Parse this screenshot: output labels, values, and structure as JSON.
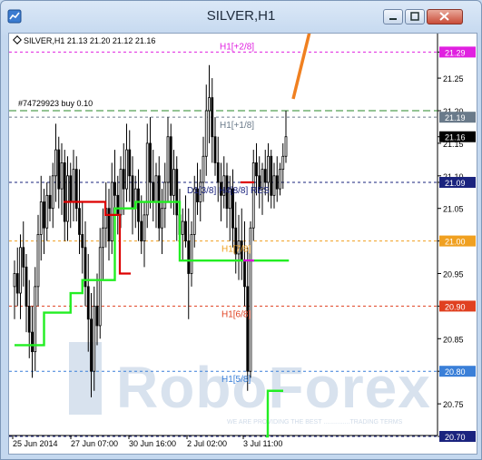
{
  "window": {
    "title": "SILVER,H1",
    "icon": "chart-window-icon",
    "controls": [
      "minimize-icon",
      "maximize-icon",
      "close-icon"
    ]
  },
  "chart_data": {
    "type": "candlestick",
    "symbol_header": "SILVER,H1  21.13 21.20 21.12 21.16",
    "trade_label": "#74729923 buy 0.10",
    "ylim": [
      20.7,
      21.3
    ],
    "y_ticks": [
      "21.29",
      "21.25",
      "21.20",
      "21.16",
      "21.15",
      "21.10",
      "21.09",
      "21.05",
      "21.00",
      "20.95",
      "20.90",
      "20.85",
      "20.80",
      "20.75",
      "20.70"
    ],
    "x_ticks": [
      "25 Jun 2014",
      "27 Jun 07:00",
      "30 Jun 16:00",
      "2 Jul 02:00",
      "3 Jul 11:00"
    ],
    "murrey_levels": [
      {
        "label": "H1[+2/8]",
        "value": 21.29,
        "badge": "21.29",
        "color": "#e020e0"
      },
      {
        "label": "H1[+1/8]",
        "value": 21.19,
        "badge": "21.19",
        "color": "#6a7a8a"
      },
      {
        "label": "D1[3/8] H4[8/8] RES",
        "value": 21.09,
        "badge": "21.09",
        "color": "#1a237e"
      },
      {
        "label": "H1[7/8]",
        "value": 21.0,
        "badge": "21.00",
        "color": "#f0a020"
      },
      {
        "label": "H1[6/8]",
        "value": 20.9,
        "badge": "20.90",
        "color": "#e04020"
      },
      {
        "label": "H1[5/8]",
        "value": 20.8,
        "badge": "20.80",
        "color": "#3a7fd8"
      },
      {
        "label": "",
        "value": 20.7,
        "badge": "20.70",
        "color": "#1a237e"
      }
    ],
    "trade_line": {
      "value": 21.2,
      "color": "#2a8a2a"
    },
    "last_price_badge": "21.16",
    "arrow_color": "#f08020",
    "watermark": {
      "brand": "RoboForex",
      "tagline": "WE ARE PROVIDING THE BEST ...............TRADING TERMS"
    },
    "trend_series": {
      "colors": {
        "up": "#22ee22",
        "down": "#dd0000",
        "flat": "#dd00dd"
      },
      "values": [
        20.84,
        20.84,
        20.84,
        20.84,
        20.84,
        20.84,
        20.84,
        20.84,
        20.84,
        20.84,
        20.89,
        20.89,
        20.89,
        20.89,
        20.89,
        20.89,
        20.89,
        20.89,
        20.89,
        20.92,
        20.92,
        20.92,
        20.92,
        20.94,
        20.94,
        20.94,
        20.94,
        20.94,
        20.94,
        20.94,
        20.94,
        20.94,
        20.94,
        20.94,
        21.05,
        21.05,
        21.05,
        21.05,
        21.05,
        21.05,
        21.05,
        21.06,
        21.06,
        21.06,
        21.06,
        21.06,
        21.06,
        21.06,
        21.06,
        21.06,
        21.06,
        21.06,
        21.06,
        21.06,
        21.06,
        21.06,
        20.97,
        20.97,
        20.97,
        20.97,
        20.97,
        20.97,
        20.97,
        20.97,
        20.97,
        20.97,
        20.97,
        20.97,
        20.97,
        20.97,
        20.97,
        20.97,
        20.97,
        20.97,
        20.97,
        20.97,
        20.97,
        20.97,
        20.97,
        20.97,
        20.97,
        20.97,
        20.97,
        20.97,
        20.97,
        20.97,
        20.97,
        20.97,
        20.97,
        20.97,
        20.97,
        20.97,
        20.97,
        20.97
      ]
    },
    "candles": [
      {
        "o": 20.93,
        "h": 20.97,
        "l": 20.88,
        "c": 20.95
      },
      {
        "o": 20.95,
        "h": 20.99,
        "l": 20.9,
        "c": 20.92
      },
      {
        "o": 20.92,
        "h": 21.01,
        "l": 20.88,
        "c": 20.99
      },
      {
        "o": 20.99,
        "h": 21.03,
        "l": 20.93,
        "c": 20.96
      },
      {
        "o": 20.96,
        "h": 20.98,
        "l": 20.86,
        "c": 20.9
      },
      {
        "o": 20.9,
        "h": 20.94,
        "l": 20.82,
        "c": 20.86
      },
      {
        "o": 20.86,
        "h": 20.9,
        "l": 20.79,
        "c": 20.83
      },
      {
        "o": 20.83,
        "h": 20.96,
        "l": 20.8,
        "c": 20.93
      },
      {
        "o": 20.93,
        "h": 21.04,
        "l": 20.9,
        "c": 21.01
      },
      {
        "o": 21.01,
        "h": 21.1,
        "l": 20.97,
        "c": 21.06
      },
      {
        "o": 21.06,
        "h": 21.08,
        "l": 20.98,
        "c": 21.02
      },
      {
        "o": 21.02,
        "h": 21.09,
        "l": 21.0,
        "c": 21.07
      },
      {
        "o": 21.07,
        "h": 21.1,
        "l": 21.03,
        "c": 21.05
      },
      {
        "o": 21.05,
        "h": 21.12,
        "l": 21.02,
        "c": 21.1
      },
      {
        "o": 21.1,
        "h": 21.18,
        "l": 21.06,
        "c": 21.14
      },
      {
        "o": 21.14,
        "h": 21.16,
        "l": 21.05,
        "c": 21.08
      },
      {
        "o": 21.08,
        "h": 21.15,
        "l": 21.04,
        "c": 21.12
      },
      {
        "o": 21.12,
        "h": 21.14,
        "l": 21.0,
        "c": 21.03
      },
      {
        "o": 21.03,
        "h": 21.13,
        "l": 21.0,
        "c": 21.1
      },
      {
        "o": 21.1,
        "h": 21.12,
        "l": 21.02,
        "c": 21.06
      },
      {
        "o": 21.06,
        "h": 21.14,
        "l": 21.03,
        "c": 21.11
      },
      {
        "o": 21.11,
        "h": 21.13,
        "l": 21.03,
        "c": 21.05
      },
      {
        "o": 21.05,
        "h": 21.11,
        "l": 20.98,
        "c": 21.01
      },
      {
        "o": 21.01,
        "h": 21.06,
        "l": 20.95,
        "c": 20.99
      },
      {
        "o": 20.99,
        "h": 21.03,
        "l": 20.9,
        "c": 20.93
      },
      {
        "o": 20.93,
        "h": 20.98,
        "l": 20.83,
        "c": 20.88
      },
      {
        "o": 20.88,
        "h": 20.92,
        "l": 20.76,
        "c": 20.8
      },
      {
        "o": 20.8,
        "h": 20.93,
        "l": 20.77,
        "c": 20.9
      },
      {
        "o": 20.9,
        "h": 20.95,
        "l": 20.84,
        "c": 20.87
      },
      {
        "o": 20.87,
        "h": 21.02,
        "l": 20.85,
        "c": 20.99
      },
      {
        "o": 20.99,
        "h": 21.05,
        "l": 20.94,
        "c": 21.02
      },
      {
        "o": 21.02,
        "h": 21.09,
        "l": 20.99,
        "c": 21.05
      },
      {
        "o": 21.05,
        "h": 21.08,
        "l": 20.97,
        "c": 21.0
      },
      {
        "o": 21.0,
        "h": 21.12,
        "l": 20.98,
        "c": 21.09
      },
      {
        "o": 21.09,
        "h": 21.14,
        "l": 21.03,
        "c": 21.07
      },
      {
        "o": 21.07,
        "h": 21.1,
        "l": 21.01,
        "c": 21.04
      },
      {
        "o": 21.04,
        "h": 21.13,
        "l": 21.02,
        "c": 21.11
      },
      {
        "o": 21.11,
        "h": 21.15,
        "l": 21.04,
        "c": 21.08
      },
      {
        "o": 21.08,
        "h": 21.18,
        "l": 21.06,
        "c": 21.14
      },
      {
        "o": 21.14,
        "h": 21.17,
        "l": 21.06,
        "c": 21.1
      },
      {
        "o": 21.1,
        "h": 21.13,
        "l": 21.01,
        "c": 21.05
      },
      {
        "o": 21.05,
        "h": 21.1,
        "l": 21.02,
        "c": 21.08
      },
      {
        "o": 21.08,
        "h": 21.11,
        "l": 21.0,
        "c": 21.03
      },
      {
        "o": 21.03,
        "h": 21.07,
        "l": 20.98,
        "c": 21.0
      },
      {
        "o": 21.0,
        "h": 21.06,
        "l": 20.96,
        "c": 21.04
      },
      {
        "o": 21.04,
        "h": 21.18,
        "l": 21.02,
        "c": 21.15
      },
      {
        "o": 21.15,
        "h": 21.19,
        "l": 21.05,
        "c": 21.09
      },
      {
        "o": 21.09,
        "h": 21.14,
        "l": 21.03,
        "c": 21.06
      },
      {
        "o": 21.06,
        "h": 21.12,
        "l": 21.02,
        "c": 21.1
      },
      {
        "o": 21.1,
        "h": 21.13,
        "l": 21.0,
        "c": 21.02
      },
      {
        "o": 21.02,
        "h": 21.08,
        "l": 20.98,
        "c": 21.05
      },
      {
        "o": 21.05,
        "h": 21.12,
        "l": 21.02,
        "c": 21.09
      },
      {
        "o": 21.09,
        "h": 21.19,
        "l": 21.06,
        "c": 21.16
      },
      {
        "o": 21.16,
        "h": 21.18,
        "l": 21.05,
        "c": 21.07
      },
      {
        "o": 21.07,
        "h": 21.14,
        "l": 21.04,
        "c": 21.11
      },
      {
        "o": 21.11,
        "h": 21.13,
        "l": 21.0,
        "c": 21.04
      },
      {
        "o": 21.04,
        "h": 21.08,
        "l": 20.98,
        "c": 21.01
      },
      {
        "o": 21.01,
        "h": 21.05,
        "l": 20.97,
        "c": 21.03
      },
      {
        "o": 21.03,
        "h": 21.07,
        "l": 20.99,
        "c": 21.0
      },
      {
        "o": 21.0,
        "h": 21.05,
        "l": 20.88,
        "c": 20.95
      },
      {
        "o": 20.95,
        "h": 21.03,
        "l": 20.93,
        "c": 21.01
      },
      {
        "o": 21.01,
        "h": 21.1,
        "l": 20.99,
        "c": 21.08
      },
      {
        "o": 21.08,
        "h": 21.12,
        "l": 21.04,
        "c": 21.06
      },
      {
        "o": 21.06,
        "h": 21.11,
        "l": 21.03,
        "c": 21.09
      },
      {
        "o": 21.09,
        "h": 21.16,
        "l": 21.06,
        "c": 21.13
      },
      {
        "o": 21.13,
        "h": 21.24,
        "l": 21.1,
        "c": 21.2
      },
      {
        "o": 21.2,
        "h": 21.27,
        "l": 21.15,
        "c": 21.22
      },
      {
        "o": 21.22,
        "h": 21.25,
        "l": 21.12,
        "c": 21.16
      },
      {
        "o": 21.16,
        "h": 21.19,
        "l": 21.1,
        "c": 21.12
      },
      {
        "o": 21.12,
        "h": 21.16,
        "l": 21.06,
        "c": 21.09
      },
      {
        "o": 21.09,
        "h": 21.12,
        "l": 21.03,
        "c": 21.07
      },
      {
        "o": 21.07,
        "h": 21.13,
        "l": 21.05,
        "c": 21.1
      },
      {
        "o": 21.1,
        "h": 21.12,
        "l": 21.02,
        "c": 21.05
      },
      {
        "o": 21.05,
        "h": 21.1,
        "l": 21.0,
        "c": 21.08
      },
      {
        "o": 21.08,
        "h": 21.11,
        "l": 20.99,
        "c": 21.02
      },
      {
        "o": 21.02,
        "h": 21.06,
        "l": 20.95,
        "c": 20.98
      },
      {
        "o": 20.98,
        "h": 21.04,
        "l": 20.94,
        "c": 21.0
      },
      {
        "o": 21.0,
        "h": 21.05,
        "l": 20.94,
        "c": 20.97
      },
      {
        "o": 20.97,
        "h": 21.03,
        "l": 20.9,
        "c": 20.93
      },
      {
        "o": 20.93,
        "h": 20.99,
        "l": 20.77,
        "c": 20.8
      },
      {
        "o": 20.8,
        "h": 21.03,
        "l": 20.79,
        "c": 21.02
      },
      {
        "o": 21.02,
        "h": 21.14,
        "l": 21.0,
        "c": 21.12
      },
      {
        "o": 21.12,
        "h": 21.15,
        "l": 21.07,
        "c": 21.1
      },
      {
        "o": 21.1,
        "h": 21.13,
        "l": 21.05,
        "c": 21.08
      },
      {
        "o": 21.08,
        "h": 21.12,
        "l": 21.04,
        "c": 21.11
      },
      {
        "o": 21.11,
        "h": 21.14,
        "l": 21.07,
        "c": 21.09
      },
      {
        "o": 21.09,
        "h": 21.15,
        "l": 21.06,
        "c": 21.13
      },
      {
        "o": 21.13,
        "h": 21.14,
        "l": 21.05,
        "c": 21.07
      },
      {
        "o": 21.07,
        "h": 21.12,
        "l": 21.05,
        "c": 21.1
      },
      {
        "o": 21.1,
        "h": 21.13,
        "l": 21.06,
        "c": 21.08
      },
      {
        "o": 21.08,
        "h": 21.12,
        "l": 21.07,
        "c": 21.11
      },
      {
        "o": 21.11,
        "h": 21.15,
        "l": 21.08,
        "c": 21.13
      },
      {
        "o": 21.13,
        "h": 21.2,
        "l": 21.12,
        "c": 21.16
      }
    ]
  }
}
